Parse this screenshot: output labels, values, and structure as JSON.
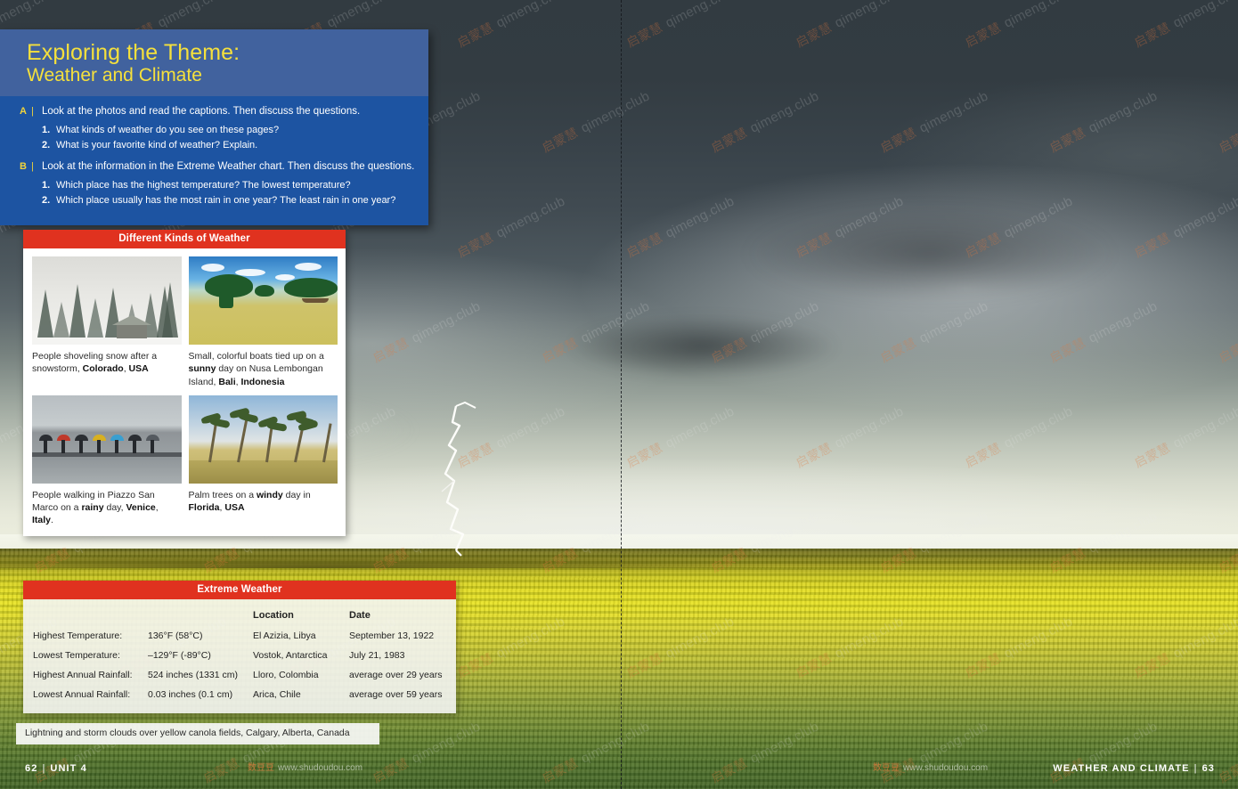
{
  "theme_panel": {
    "title_line1": "Exploring the Theme:",
    "title_line2": "Weather and Climate",
    "exercises": [
      {
        "letter": "A",
        "separator": "|",
        "instruction": "Look at the photos and read the captions. Then discuss the questions.",
        "questions": [
          {
            "num": "1.",
            "text": "What kinds of weather do you see on these pages?"
          },
          {
            "num": "2.",
            "text": "What is your favorite kind of weather? Explain."
          }
        ]
      },
      {
        "letter": "B",
        "separator": "|",
        "instruction": "Look at the information in the Extreme Weather chart. Then discuss the questions.",
        "questions": [
          {
            "num": "1.",
            "text": "Which place has the highest temperature? The lowest temperature?"
          },
          {
            "num": "2.",
            "text": "Which place usually has the most rain in one year? The least rain in one year?"
          }
        ]
      }
    ]
  },
  "photo_panel": {
    "header": "Different Kinds of Weather",
    "photos": [
      {
        "image_name": "snowy-forest-photo",
        "caption_pre": "People shoveling snow after a snowstorm, ",
        "caption_bold": "Colorado",
        "caption_mid": ", ",
        "caption_bold2": "USA",
        "caption_post": ""
      },
      {
        "image_name": "tropical-boats-photo",
        "caption_pre": "Small, colorful boats tied up on a ",
        "caption_bold": "sunny",
        "caption_mid": " day on Nusa Lembongan Island, ",
        "caption_bold2": "Bali",
        "caption_post": ", ",
        "caption_bold3": "Indonesia"
      },
      {
        "image_name": "rainy-piazza-photo",
        "caption_pre": "People walking in Piazzo San Marco on a ",
        "caption_bold": "rainy",
        "caption_mid": " day, ",
        "caption_bold2": "Venice",
        "caption_post": ", ",
        "caption_bold3": "Italy",
        "caption_end": "."
      },
      {
        "image_name": "windy-palms-photo",
        "caption_pre": "Palm trees on a ",
        "caption_bold": "windy",
        "caption_mid": " day in ",
        "caption_bold2": "Florida",
        "caption_post": ", ",
        "caption_bold3": "USA"
      }
    ]
  },
  "extreme_weather": {
    "header": "Extreme Weather",
    "columns": [
      "",
      "",
      "Location",
      "Date"
    ],
    "rows": [
      {
        "label": "Highest Temperature:",
        "value": "136°F (58°C)",
        "location": "El Azizia, Libya",
        "date": "September 13, 1922"
      },
      {
        "label": "Lowest Temperature:",
        "value": "–129°F (-89°C)",
        "location": "Vostok, Antarctica",
        "date": "July 21, 1983"
      },
      {
        "label": "Highest Annual Rainfall:",
        "value": "524 inches (1331 cm)",
        "location": "Lloro, Colombia",
        "date": "average over 29 years"
      },
      {
        "label": "Lowest Annual Rainfall:",
        "value": "0.03 inches (0.1 cm)",
        "location": "Arica, Chile",
        "date": "average over 59 years"
      }
    ]
  },
  "background": {
    "photo_credit": "Lightning and storm clouds over yellow canola fields, Calgary, Alberta, Canada",
    "image_name": "storm-over-canola-field"
  },
  "footer": {
    "left_page": "62",
    "left_separator": "|",
    "left_label": "UNIT 4",
    "right_label": "WEATHER AND CLIMATE",
    "right_separator": "|",
    "right_page": "63"
  },
  "watermark": {
    "cn": "启蒙慧",
    "url": "qimeng.club",
    "footer_cn": "数豆豆",
    "footer_url": "www.shudoudou.com"
  },
  "colors": {
    "theme_header_blue": "#41629e",
    "theme_body_blue": "#1d54a2",
    "title_yellow": "#f5e03c",
    "accent_red": "#e0321f",
    "panel_white": "#ffffff"
  }
}
